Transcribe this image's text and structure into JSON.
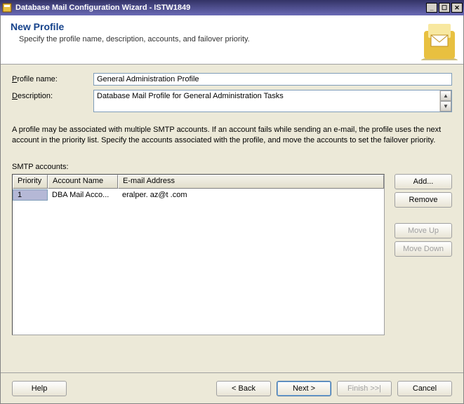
{
  "window": {
    "title": "Database Mail Configuration Wizard - ISTW1849"
  },
  "header": {
    "title": "New Profile",
    "subtitle": "Specify the profile name, description, accounts, and failover priority."
  },
  "form": {
    "profile_name_label": "Profile name:",
    "profile_name_value": "General Administration Profile",
    "description_label": "Description:",
    "description_value": "Database Mail Profile for General Administration Tasks"
  },
  "help_text": "A profile may be associated with multiple SMTP accounts. If an account fails while sending an e-mail, the profile uses the next account in the priority list. Specify the accounts associated with the profile, and move the accounts to set the failover priority.",
  "accounts": {
    "label": "SMTP accounts:",
    "columns": {
      "priority": "Priority",
      "account": "Account Name",
      "email": "E-mail Address"
    },
    "rows": [
      {
        "priority": "1",
        "account": "DBA Mail Acco...",
        "email": "eralper.   az@t       .com"
      }
    ]
  },
  "side": {
    "add": "Add...",
    "remove": "Remove",
    "move_up": "Move Up",
    "move_down": "Move Down"
  },
  "footer": {
    "help": "Help",
    "back": "< Back",
    "next": "Next >",
    "finish": "Finish >>|",
    "cancel": "Cancel"
  }
}
